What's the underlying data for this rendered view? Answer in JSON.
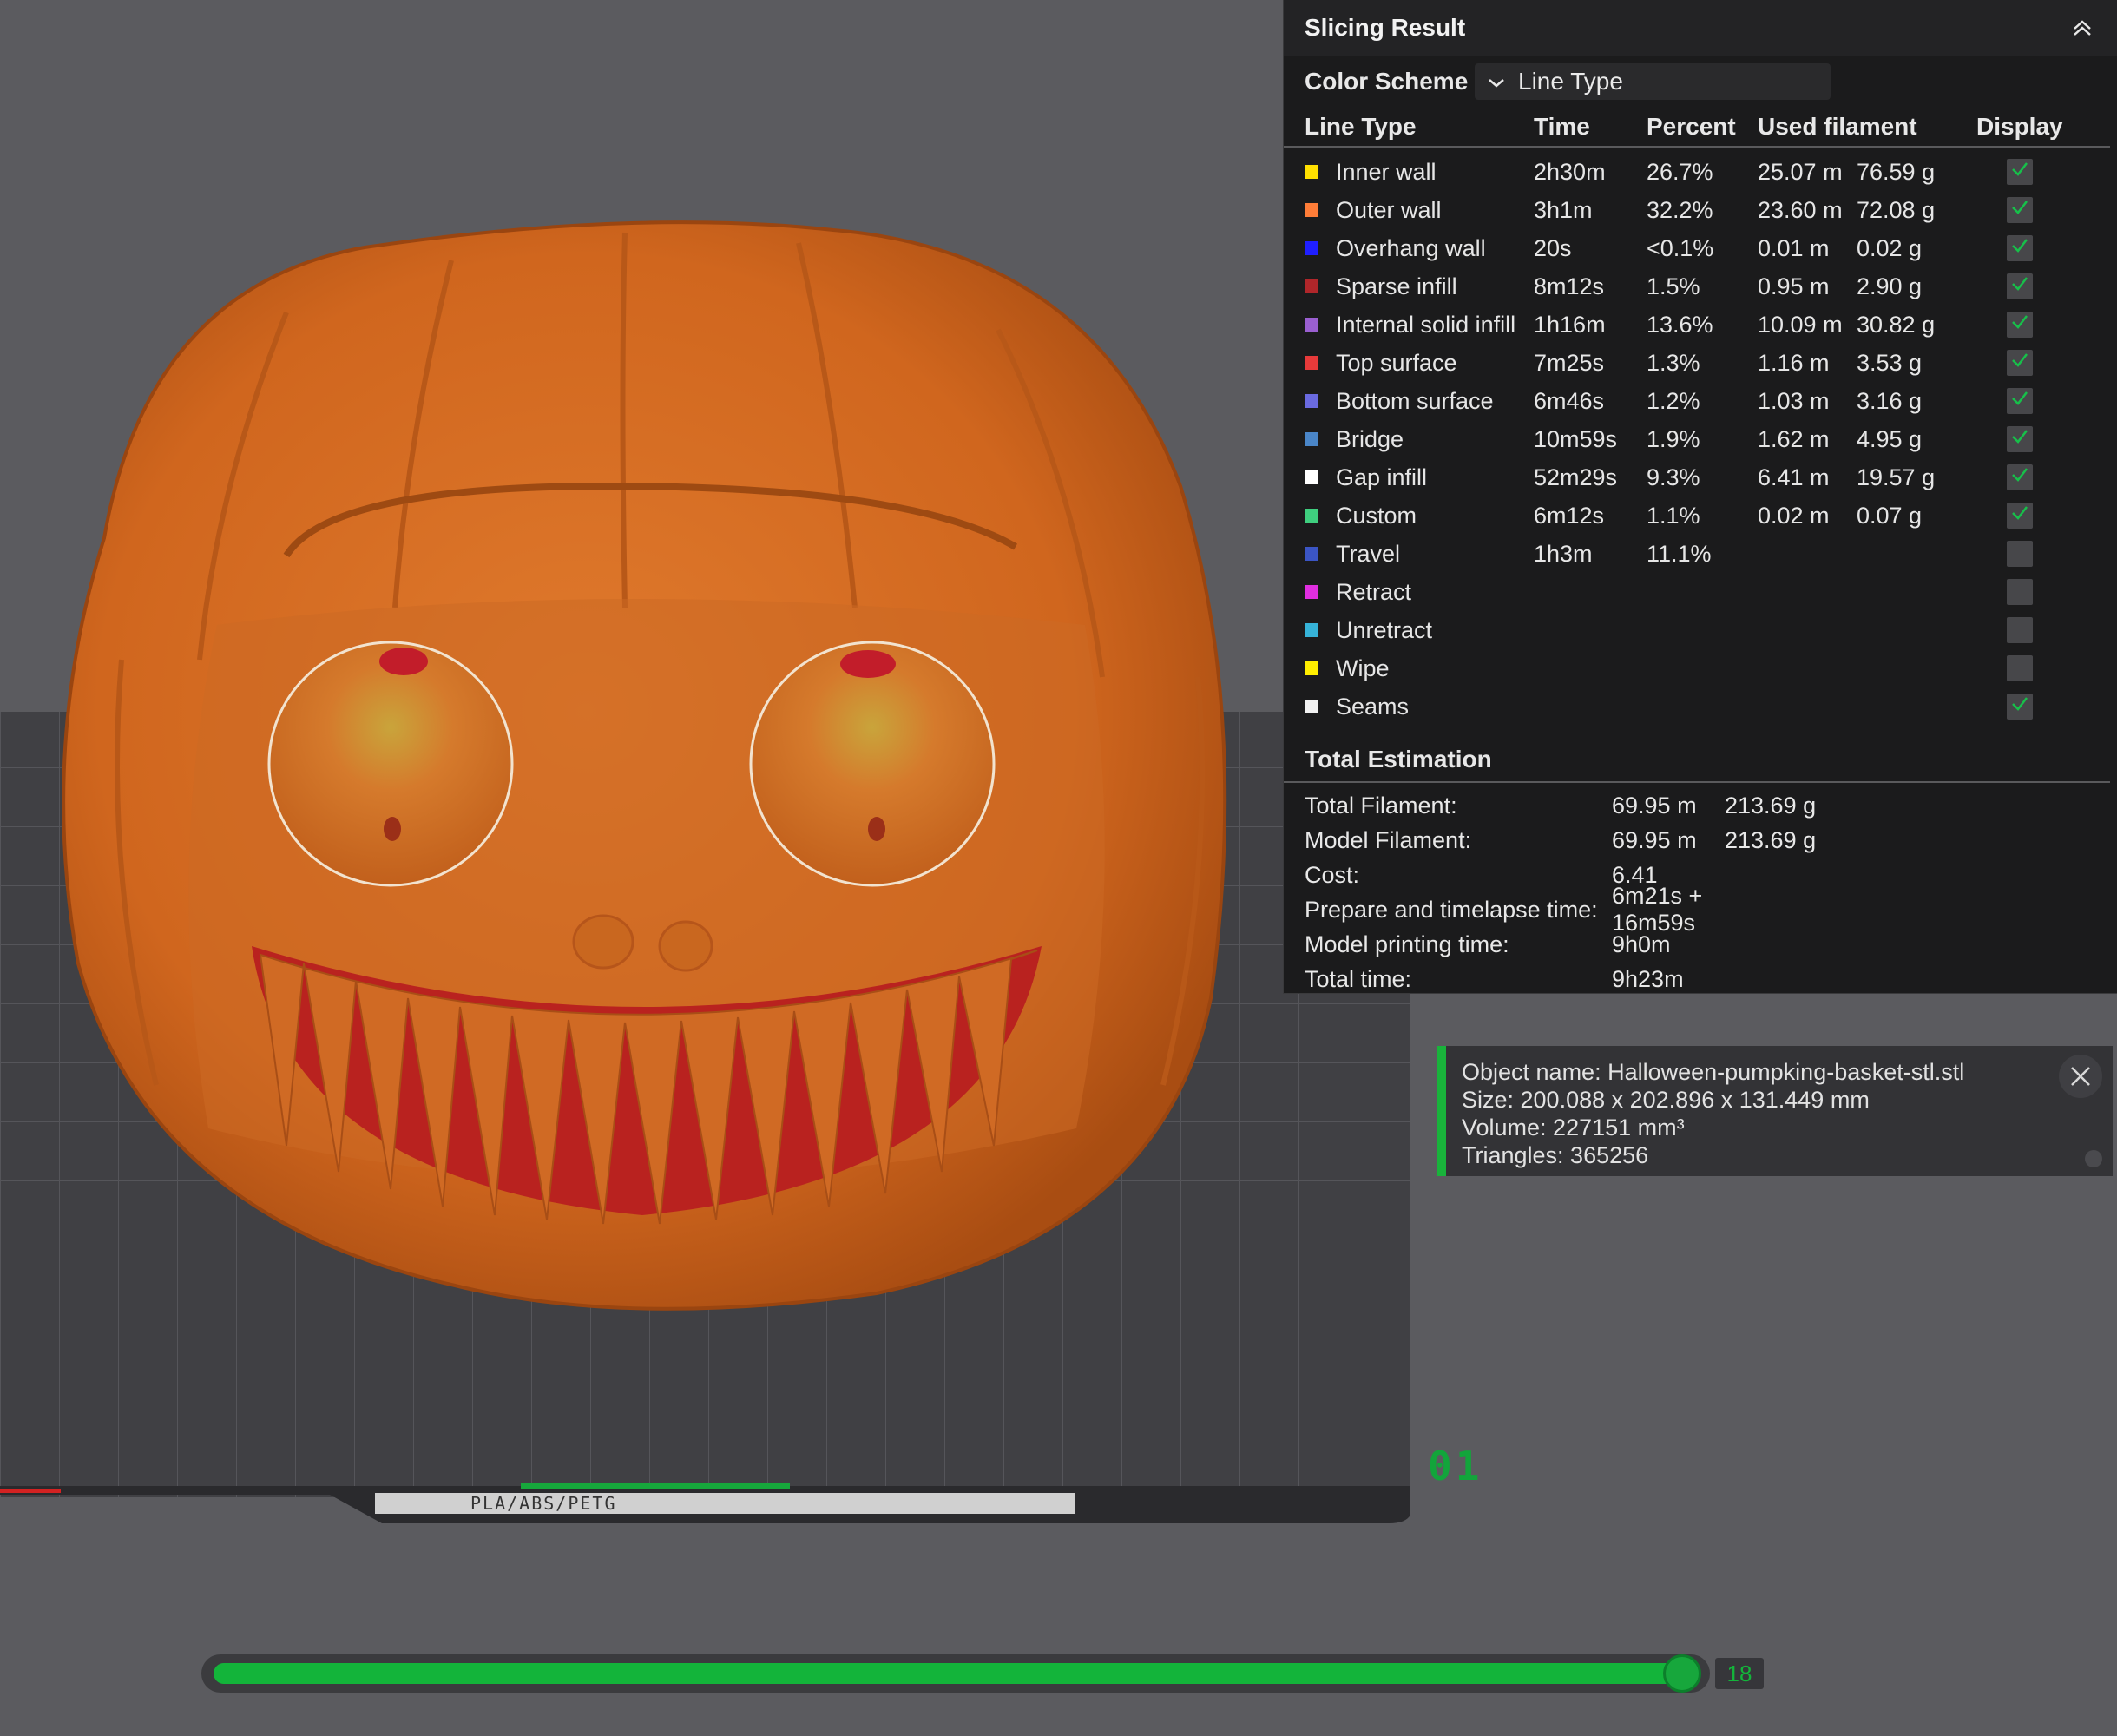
{
  "panel": {
    "title": "Slicing Result",
    "color_scheme_label": "Color Scheme",
    "color_scheme_value": "Line Type",
    "columns": {
      "type": "Line Type",
      "time": "Time",
      "percent": "Percent",
      "used": "Used filament",
      "display": "Display"
    },
    "rows": [
      {
        "label": "Inner wall",
        "color": "#ffe000",
        "time": "2h30m",
        "percent": "26.7%",
        "length": "25.07 m",
        "weight": "76.59 g",
        "checked": true
      },
      {
        "label": "Outer wall",
        "color": "#ff7d38",
        "time": "3h1m",
        "percent": "32.2%",
        "length": "23.60 m",
        "weight": "72.08 g",
        "checked": true
      },
      {
        "label": "Overhang wall",
        "color": "#1f1fff",
        "time": "20s",
        "percent": "<0.1%",
        "length": "0.01 m",
        "weight": "0.02 g",
        "checked": true
      },
      {
        "label": "Sparse infill",
        "color": "#b0262a",
        "time": "8m12s",
        "percent": "1.5%",
        "length": "0.95 m",
        "weight": "2.90 g",
        "checked": true
      },
      {
        "label": "Internal solid infill",
        "color": "#9a5fd0",
        "time": "1h16m",
        "percent": "13.6%",
        "length": "10.09 m",
        "weight": "30.82 g",
        "checked": true
      },
      {
        "label": "Top surface",
        "color": "#e73a3a",
        "time": "7m25s",
        "percent": "1.3%",
        "length": "1.16 m",
        "weight": "3.53 g",
        "checked": true
      },
      {
        "label": "Bottom surface",
        "color": "#6a6ae0",
        "time": "6m46s",
        "percent": "1.2%",
        "length": "1.03 m",
        "weight": "3.16 g",
        "checked": true
      },
      {
        "label": "Bridge",
        "color": "#4a86c8",
        "time": "10m59s",
        "percent": "1.9%",
        "length": "1.62 m",
        "weight": "4.95 g",
        "checked": true
      },
      {
        "label": "Gap infill",
        "color": "#ffffff",
        "time": "52m29s",
        "percent": "9.3%",
        "length": "6.41 m",
        "weight": "19.57 g",
        "checked": true
      },
      {
        "label": "Custom",
        "color": "#3fcf7f",
        "time": "6m12s",
        "percent": "1.1%",
        "length": "0.02 m",
        "weight": "0.07 g",
        "checked": true
      },
      {
        "label": "Travel",
        "color": "#3b55c4",
        "time": "1h3m",
        "percent": "11.1%",
        "length": "",
        "weight": "",
        "checked": false
      },
      {
        "label": "Retract",
        "color": "#e02ee0",
        "time": "",
        "percent": "",
        "length": "",
        "weight": "",
        "checked": false
      },
      {
        "label": "Unretract",
        "color": "#36b3d8",
        "time": "",
        "percent": "",
        "length": "",
        "weight": "",
        "checked": false
      },
      {
        "label": "Wipe",
        "color": "#ffee00",
        "time": "",
        "percent": "",
        "length": "",
        "weight": "",
        "checked": false
      },
      {
        "label": "Seams",
        "color": "#f2f2f2",
        "time": "",
        "percent": "",
        "length": "",
        "weight": "",
        "checked": true
      }
    ],
    "total_title": "Total Estimation",
    "estimation": [
      {
        "label": "Total Filament:",
        "v1": "69.95 m",
        "v2": "213.69 g"
      },
      {
        "label": "Model Filament:",
        "v1": "69.95 m",
        "v2": "213.69 g"
      },
      {
        "label": "Cost:",
        "v1": "6.41",
        "v2": ""
      },
      {
        "label": "Prepare and timelapse time:",
        "v1": "6m21s + 16m59s",
        "v2": ""
      },
      {
        "label": "Model printing time:",
        "v1": "9h0m",
        "v2": ""
      },
      {
        "label": "Total time:",
        "v1": "9h23m",
        "v2": ""
      }
    ]
  },
  "object_info": {
    "name": "Object name: Halloween-pumpking-basket-stl.stl",
    "size": "Size: 200.088 x 202.896 x 131.449 mm",
    "volume": "Volume: 227151 mm³",
    "triangles": "Triangles: 365256"
  },
  "plate": {
    "number": "01",
    "label": "PLA/ABS/PETG"
  },
  "layer_slider": {
    "value": "18",
    "progress": 1.0
  },
  "colors": {
    "accent_green": "#13b43a",
    "model_orange": "#d46a22",
    "panel_bg": "#1b1b1c"
  },
  "icons": [
    "collapse-up-icon",
    "chevron-down-icon",
    "checkmark-icon",
    "close-icon"
  ]
}
